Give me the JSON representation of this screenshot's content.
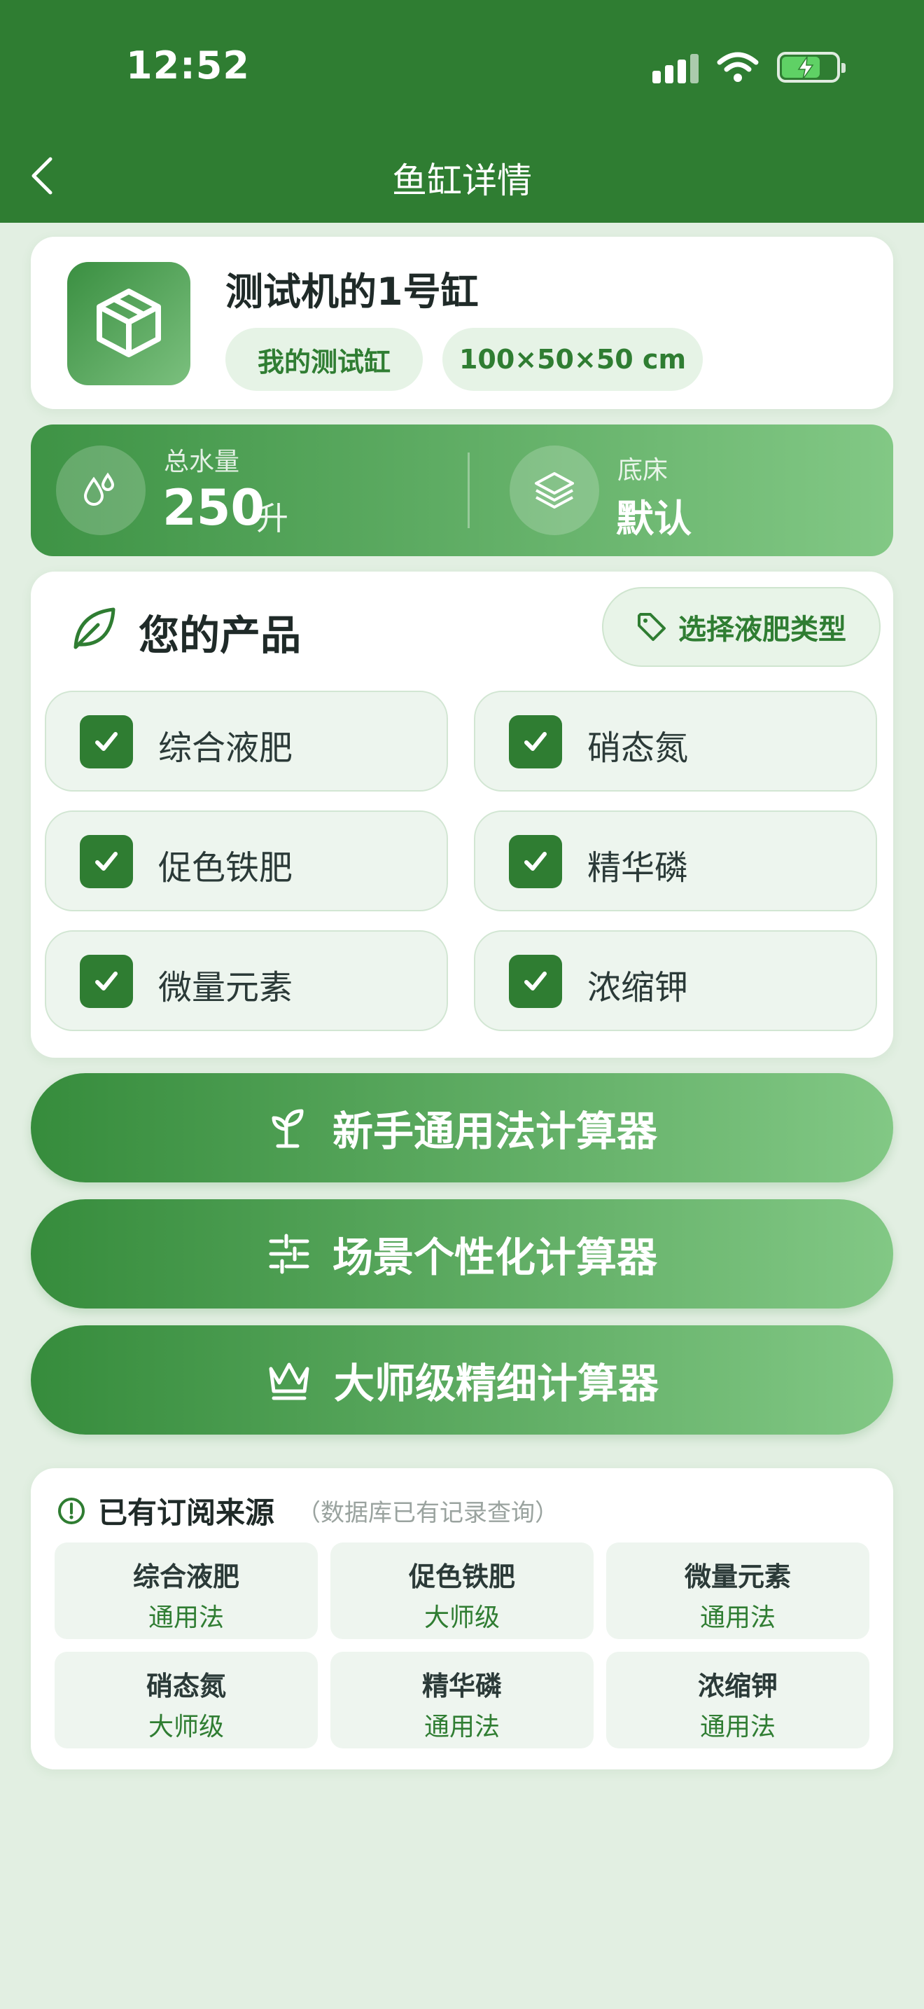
{
  "status_bar": {
    "time": "12:52"
  },
  "nav": {
    "title": "鱼缸详情"
  },
  "tank": {
    "name": "测试机的1号缸",
    "group": "我的测试缸",
    "size": "100×50×50 cm"
  },
  "stats": {
    "water": {
      "label": "总水量",
      "value": "250",
      "unit": "升"
    },
    "substrate": {
      "label": "底床",
      "value": "默认"
    }
  },
  "products": {
    "title": "您的产品",
    "select_type_label": "选择液肥类型",
    "items": [
      {
        "label": "综合液肥",
        "checked": true
      },
      {
        "label": "硝态氮",
        "checked": true
      },
      {
        "label": "促色铁肥",
        "checked": true
      },
      {
        "label": "精华磷",
        "checked": true
      },
      {
        "label": "微量元素",
        "checked": true
      },
      {
        "label": "浓缩钾",
        "checked": true
      }
    ]
  },
  "calculators": [
    {
      "label": "新手通用法计算器",
      "icon": "sprout-icon"
    },
    {
      "label": "场景个性化计算器",
      "icon": "sliders-icon"
    },
    {
      "label": "大师级精细计算器",
      "icon": "crown-icon"
    }
  ],
  "subscriptions": {
    "title": "已有订阅来源",
    "note": "（数据库已有记录查询）",
    "items": [
      {
        "name": "综合液肥",
        "level": "通用法"
      },
      {
        "name": "促色铁肥",
        "level": "大师级"
      },
      {
        "name": "微量元素",
        "level": "通用法"
      },
      {
        "name": "硝态氮",
        "level": "大师级"
      },
      {
        "name": "精华磷",
        "level": "通用法"
      },
      {
        "name": "浓缩钾",
        "level": "通用法"
      }
    ]
  },
  "colors": {
    "primary": "#2f7d32",
    "gradient_end": "#82c885",
    "background": "#e2efe2",
    "chip_bg": "#e6f3e6"
  }
}
